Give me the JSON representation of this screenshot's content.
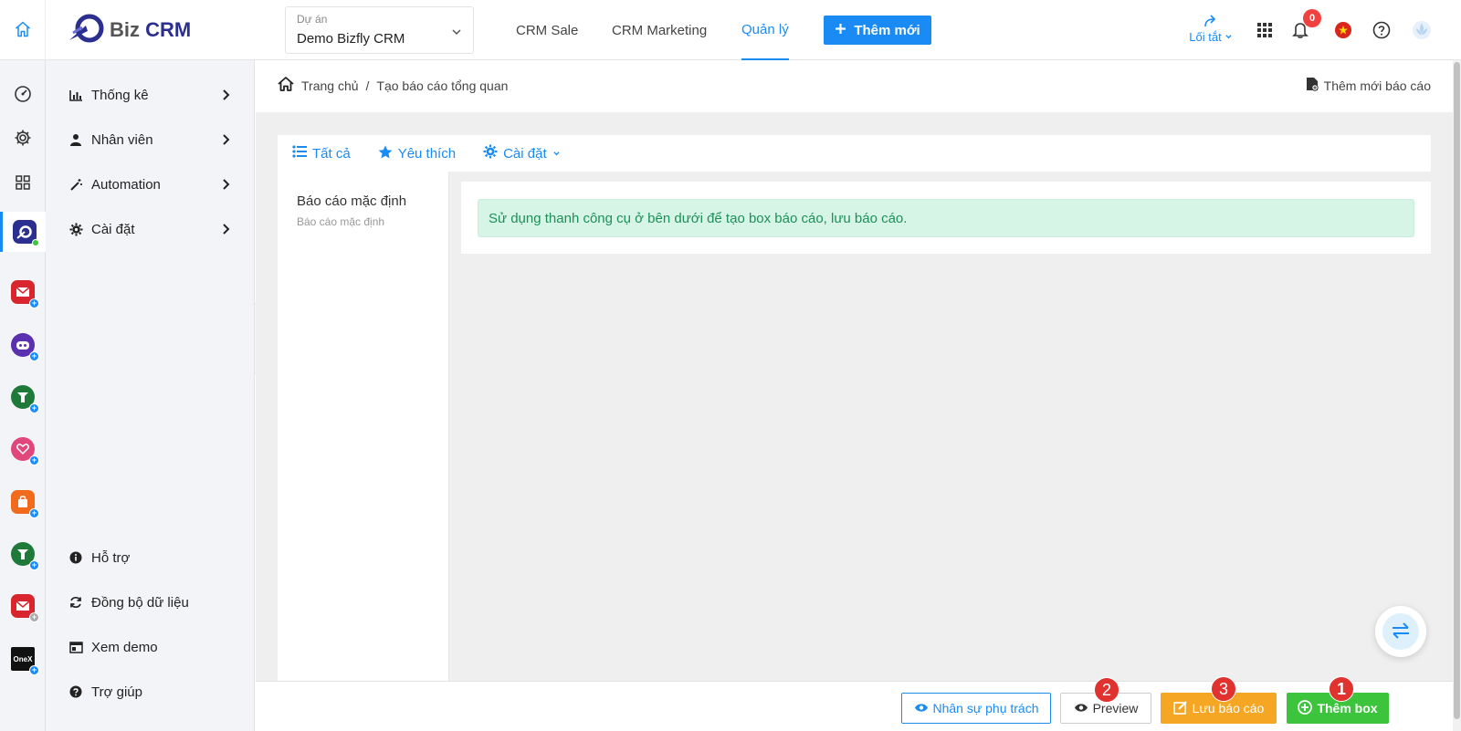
{
  "header": {
    "logo_text_1": "Biz",
    "logo_text_2": "CRM",
    "project_label": "Dự án",
    "project_value": "Demo Bizfly CRM",
    "nav": [
      {
        "label": "CRM Sale"
      },
      {
        "label": "CRM Marketing"
      },
      {
        "label": "Quản lý"
      }
    ],
    "add_new_label": "Thêm mới",
    "shortcut_label": "Lối tắt",
    "notification_count": "0",
    "accent_color": "#1a8bf5"
  },
  "rail": {
    "apps": [
      {
        "icon": "dashboard-icon"
      },
      {
        "icon": "gear-icon"
      },
      {
        "icon": "grid-icon"
      },
      {
        "icon": "bizcrm-app-icon"
      },
      {
        "icon": "bizmail-app-icon"
      },
      {
        "icon": "chatbot-app-icon"
      },
      {
        "icon": "bizfly-green-app-icon"
      },
      {
        "icon": "heart-app-icon"
      },
      {
        "icon": "shop-app-icon"
      },
      {
        "icon": "bizfly-green-app-icon-2"
      },
      {
        "icon": "bizmail-app-icon-2"
      },
      {
        "icon": "onex-app-icon",
        "text": "OneX"
      }
    ]
  },
  "sidebar": {
    "items": [
      {
        "label": "Thống kê",
        "icon": "bar-chart-icon"
      },
      {
        "label": "Nhân viên",
        "icon": "user-icon"
      },
      {
        "label": "Automation",
        "icon": "magic-wand-icon"
      },
      {
        "label": "Cài đặt",
        "icon": "gear-icon"
      }
    ],
    "bottom_items": [
      {
        "label": "Hỗ trợ",
        "icon": "info-icon"
      },
      {
        "label": "Đồng bộ dữ liệu",
        "icon": "sync-icon"
      },
      {
        "label": "Xem demo",
        "icon": "browser-icon"
      },
      {
        "label": "Trợ giúp",
        "icon": "help-icon"
      }
    ]
  },
  "breadcrumb": {
    "home": "Trang chủ",
    "separator": "/",
    "current": "Tạo báo cáo tổng quan"
  },
  "add_report_label": "Thêm mới báo cáo",
  "tabs": [
    {
      "label": "Tất cả"
    },
    {
      "label": "Yêu thích"
    },
    {
      "label": "Cài đặt"
    }
  ],
  "left_panel": {
    "title": "Báo cáo mặc định",
    "subtitle": "Báo cáo mặc định"
  },
  "alert_text": "Sử dụng thanh công cụ ở bên dưới để tạo box báo cáo, lưu báo cáo.",
  "footer": {
    "staff_label": "Nhân sự phụ trách",
    "preview_label": "Preview",
    "save_label": "Lưu báo cáo",
    "add_box_label": "Thêm box",
    "markers": [
      "2",
      "3",
      "1"
    ]
  }
}
